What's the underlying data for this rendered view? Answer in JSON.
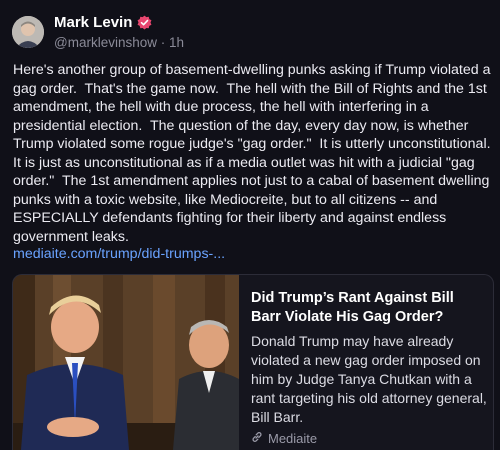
{
  "author": {
    "display_name": "Mark Levin",
    "handle": "@marklevinshow",
    "separator": "·",
    "time_ago": "1h",
    "verified_badge_color": "#e8466f"
  },
  "post": {
    "text": "Here's another group of basement-dwelling punks asking if Trump violated a gag order.  That's the game now.  The hell with the Bill of Rights and the 1st amendment, the hell with due process, the hell with interfering in a presidential election.  The question of the day, every day now, is whether Trump violated some rogue judge's \"gag order.\"  It is utterly unconstitutional.  It is just as unconstitutional as if a media outlet was hit with a judicial \"gag order.\"  The 1st amendment applies not just to a cabal of basement dwelling punks with a toxic website, like Mediocreite, but to all citizens -- and ESPECIALLY defendants fighting for their liberty and against endless government leaks.",
    "link_text": "mediaite.com/trump/did-trumps-..."
  },
  "card": {
    "title": "Did Trump’s Rant Against Bill Barr Violate His Gag Order?",
    "description": "Donald Trump may have already violated a new gag order imposed on him by Judge Tanya Chutkan with a rant targeting his old attorney general, Bill Barr.",
    "source": "Mediaite",
    "source_icon": "link-icon"
  },
  "colors": {
    "background": "#101018",
    "link": "#6aa3ff",
    "handle_gray": "#8b8b98"
  }
}
